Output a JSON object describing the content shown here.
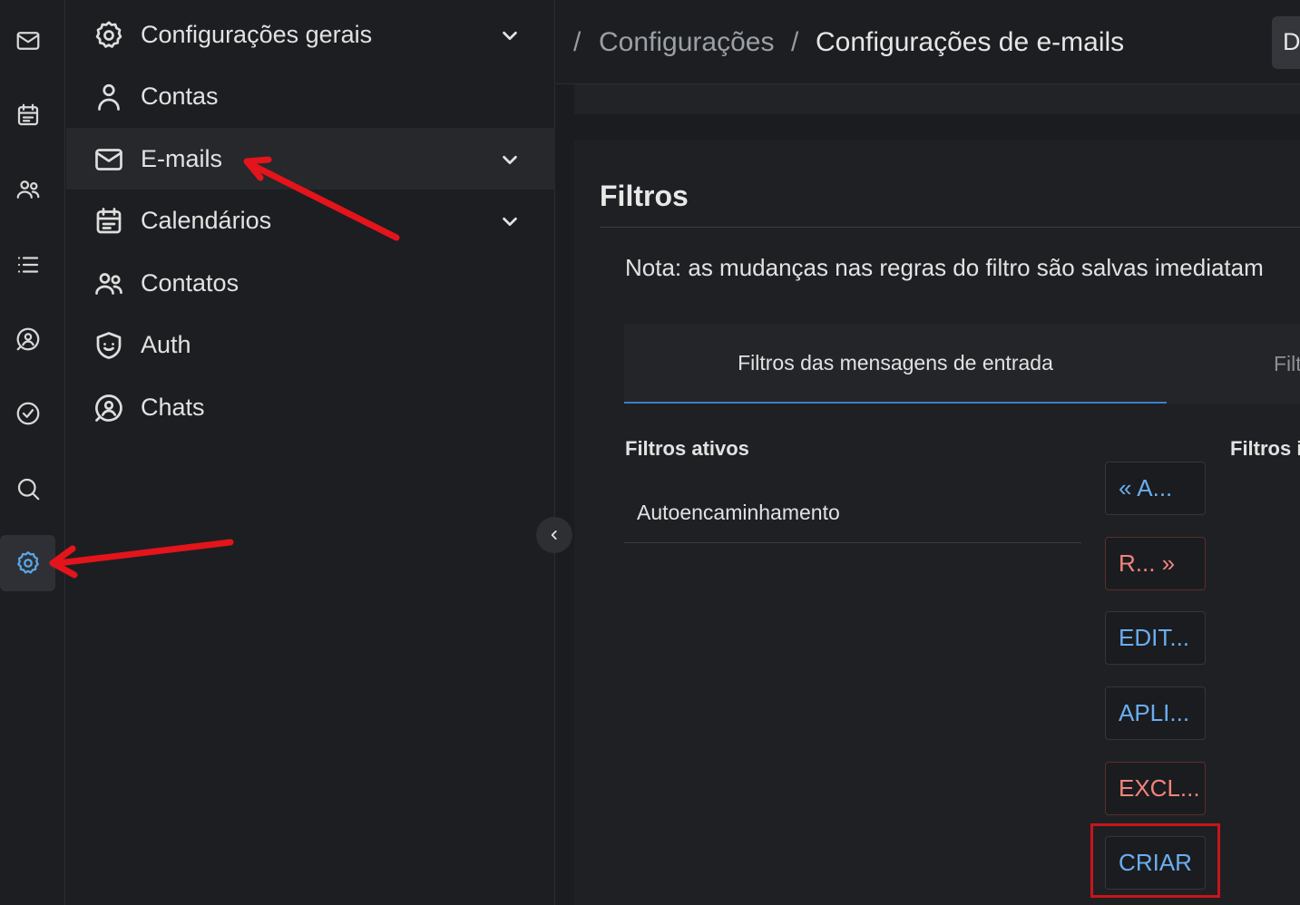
{
  "rail": {
    "items": [
      {
        "icon": "mail-icon"
      },
      {
        "icon": "calendar-icon"
      },
      {
        "icon": "contacts-icon"
      },
      {
        "icon": "list-icon"
      },
      {
        "icon": "chat-icon"
      },
      {
        "icon": "check-circle-icon"
      },
      {
        "icon": "search-icon"
      },
      {
        "icon": "gear-icon",
        "active": true
      }
    ]
  },
  "sidebar": {
    "items": [
      {
        "label": "Configurações gerais",
        "icon": "gear-icon",
        "expandable": true
      },
      {
        "label": "Contas",
        "icon": "user-icon"
      },
      {
        "label": "E-mails",
        "icon": "mail-icon",
        "expandable": true,
        "active": true
      },
      {
        "label": "Calendários",
        "icon": "calendar-icon",
        "expandable": true
      },
      {
        "label": "Contatos",
        "icon": "contacts-icon"
      },
      {
        "label": "Auth",
        "icon": "shield-icon"
      },
      {
        "label": "Chats",
        "icon": "chat-icon"
      }
    ]
  },
  "breadcrumb": {
    "sep": "/",
    "parent": "Configurações",
    "current": "Configurações de e-mails"
  },
  "top_button": "D",
  "filters": {
    "title": "Filtros",
    "note": "Nota: as mudanças nas regras do filtro são salvas imediatam",
    "tabs": [
      "Filtros das mensagens de entrada",
      "Filt"
    ],
    "active_header": "Filtros ativos",
    "inactive_header": "Filtros i",
    "active_list": [
      "Autoencaminhamento"
    ],
    "buttons": {
      "activate": "« A...",
      "remove": "R... »",
      "edit": "EDIT...",
      "apply": "APLI...",
      "delete": "EXCL...",
      "create": "CRIAR"
    }
  },
  "colors": {
    "accent": "#5aa7e8",
    "danger": "#f2847c",
    "annotation": "#e3141b"
  }
}
